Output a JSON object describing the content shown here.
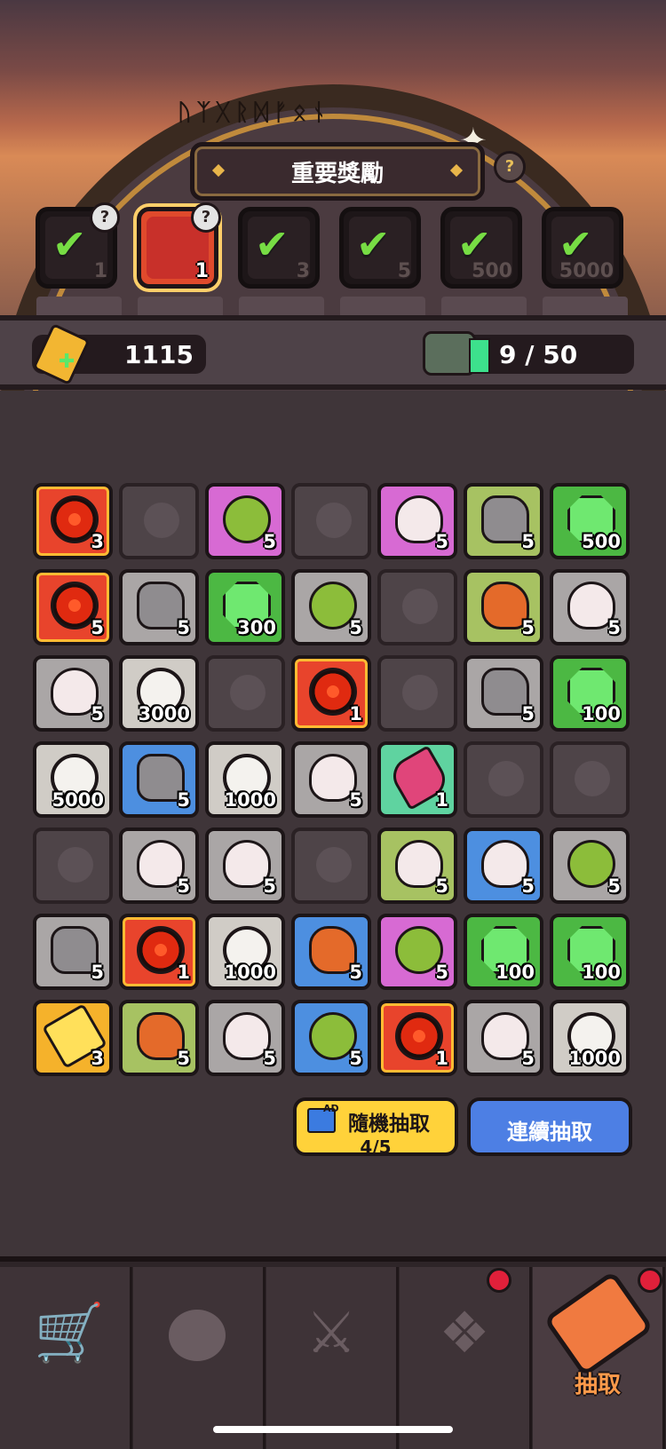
{
  "header": {
    "title": "重要獎勵",
    "help": "?"
  },
  "rewards": [
    {
      "num": "1",
      "claimed": true,
      "help": "?"
    },
    {
      "num": "1",
      "claimed": false,
      "help": "?"
    },
    {
      "num": "3",
      "claimed": true
    },
    {
      "num": "5",
      "claimed": true
    },
    {
      "num": "500",
      "claimed": true
    },
    {
      "num": "5000",
      "claimed": true
    }
  ],
  "resources": {
    "tickets": "1115",
    "progress": "9 / 50"
  },
  "grid": [
    [
      {
        "t": "eye",
        "c": "c-red",
        "q": "3"
      },
      {
        "t": "empty",
        "c": "c-empty",
        "q": ""
      },
      {
        "t": "goblin",
        "c": "c-purple",
        "q": "5"
      },
      {
        "t": "empty",
        "c": "c-empty",
        "q": ""
      },
      {
        "t": "skull",
        "c": "c-purple",
        "q": "5"
      },
      {
        "t": "rock",
        "c": "c-lime",
        "q": "5"
      },
      {
        "t": "gem",
        "c": "c-green",
        "q": "500"
      }
    ],
    [
      {
        "t": "eye",
        "c": "c-red",
        "q": "5"
      },
      {
        "t": "rock",
        "c": "c-grey",
        "q": "5"
      },
      {
        "t": "gem",
        "c": "c-green",
        "q": "300"
      },
      {
        "t": "goblin",
        "c": "c-grey",
        "q": "5"
      },
      {
        "t": "empty",
        "c": "c-empty",
        "q": ""
      },
      {
        "t": "dragon",
        "c": "c-lime",
        "q": "5"
      },
      {
        "t": "skull",
        "c": "c-grey",
        "q": "5"
      }
    ],
    [
      {
        "t": "skull",
        "c": "c-grey",
        "q": "5"
      },
      {
        "t": "coin",
        "c": "c-white",
        "q": "3000"
      },
      {
        "t": "empty",
        "c": "c-empty",
        "q": ""
      },
      {
        "t": "eye",
        "c": "c-red",
        "q": "1"
      },
      {
        "t": "empty",
        "c": "c-empty",
        "q": ""
      },
      {
        "t": "rock",
        "c": "c-grey",
        "q": "5"
      },
      {
        "t": "gem",
        "c": "c-green",
        "q": "100"
      }
    ],
    [
      {
        "t": "coin",
        "c": "c-white",
        "q": "5000"
      },
      {
        "t": "rock",
        "c": "c-blue",
        "q": "5"
      },
      {
        "t": "coin",
        "c": "c-white",
        "q": "1000"
      },
      {
        "t": "skull",
        "c": "c-grey",
        "q": "5"
      },
      {
        "t": "feather",
        "c": "c-teal",
        "q": "1"
      },
      {
        "t": "empty",
        "c": "c-empty",
        "q": ""
      },
      {
        "t": "empty",
        "c": "c-empty",
        "q": ""
      }
    ],
    [
      {
        "t": "empty",
        "c": "c-empty",
        "q": ""
      },
      {
        "t": "skull",
        "c": "c-grey",
        "q": "5"
      },
      {
        "t": "skull",
        "c": "c-grey",
        "q": "5"
      },
      {
        "t": "empty",
        "c": "c-empty",
        "q": ""
      },
      {
        "t": "skull",
        "c": "c-lime",
        "q": "5"
      },
      {
        "t": "skull",
        "c": "c-blue",
        "q": "5"
      },
      {
        "t": "goblin",
        "c": "c-grey",
        "q": "5"
      }
    ],
    [
      {
        "t": "rock",
        "c": "c-grey",
        "q": "5"
      },
      {
        "t": "eye",
        "c": "c-red",
        "q": "1"
      },
      {
        "t": "coin",
        "c": "c-white",
        "q": "1000"
      },
      {
        "t": "dragon",
        "c": "c-blue",
        "q": "5"
      },
      {
        "t": "goblin",
        "c": "c-purple",
        "q": "5"
      },
      {
        "t": "gem",
        "c": "c-green",
        "q": "100"
      },
      {
        "t": "gem",
        "c": "c-green",
        "q": "100"
      }
    ],
    [
      {
        "t": "ticket",
        "c": "c-gold",
        "q": "3"
      },
      {
        "t": "dragon",
        "c": "c-lime",
        "q": "5"
      },
      {
        "t": "skull",
        "c": "c-grey",
        "q": "5"
      },
      {
        "t": "goblin",
        "c": "c-blue",
        "q": "5"
      },
      {
        "t": "eye",
        "c": "c-red",
        "q": "1"
      },
      {
        "t": "skull",
        "c": "c-grey",
        "q": "5"
      },
      {
        "t": "coin",
        "c": "c-white",
        "q": "1000"
      }
    ]
  ],
  "buttons": {
    "random_label": "隨機抽取",
    "random_count": "4/5",
    "ad_tag": "AD",
    "continuous_label": "連續抽取"
  },
  "tabs": [
    {
      "name": "shop",
      "icon": "cart-icon",
      "glyph": "🛒",
      "label": ""
    },
    {
      "name": "monster",
      "icon": "monster-icon",
      "glyph": "",
      "label": ""
    },
    {
      "name": "battle",
      "icon": "crossed-swords-icon",
      "glyph": "⚔",
      "label": ""
    },
    {
      "name": "rank",
      "icon": "winged-shield-icon",
      "glyph": "❖",
      "label": ""
    },
    {
      "name": "draw",
      "icon": "ticket-icon",
      "glyph": "",
      "label": "抽取"
    }
  ]
}
